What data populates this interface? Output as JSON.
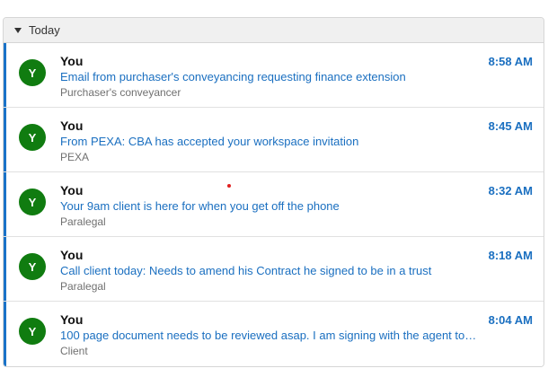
{
  "group": {
    "label": "Today"
  },
  "items": [
    {
      "avatar": "Y",
      "sender": "You",
      "subject": "Email from purchaser's conveyancing requesting finance extension",
      "preview": "Purchaser's conveyancer",
      "time": "8:58 AM"
    },
    {
      "avatar": "Y",
      "sender": "You",
      "subject": "From PEXA: CBA has accepted your workspace invitation",
      "preview": "PEXA",
      "time": "8:45 AM"
    },
    {
      "avatar": "Y",
      "sender": "You",
      "subject": "Your 9am client is here for when you get off the phone",
      "preview": "Paralegal",
      "time": "8:32 AM"
    },
    {
      "avatar": "Y",
      "sender": "You",
      "subject": "Call client today: Needs to amend his Contract he signed to be in a trust",
      "preview": "Paralegal",
      "time": "8:18 AM"
    },
    {
      "avatar": "Y",
      "sender": "You",
      "subject": "100 page document needs to be reviewed asap. I am signing with the agent tonight ...",
      "preview": "Client",
      "time": "8:04 AM"
    }
  ],
  "colors": {
    "accent": "#1a73c8",
    "avatar_bg": "#107c10",
    "link": "#1a6fc0"
  }
}
